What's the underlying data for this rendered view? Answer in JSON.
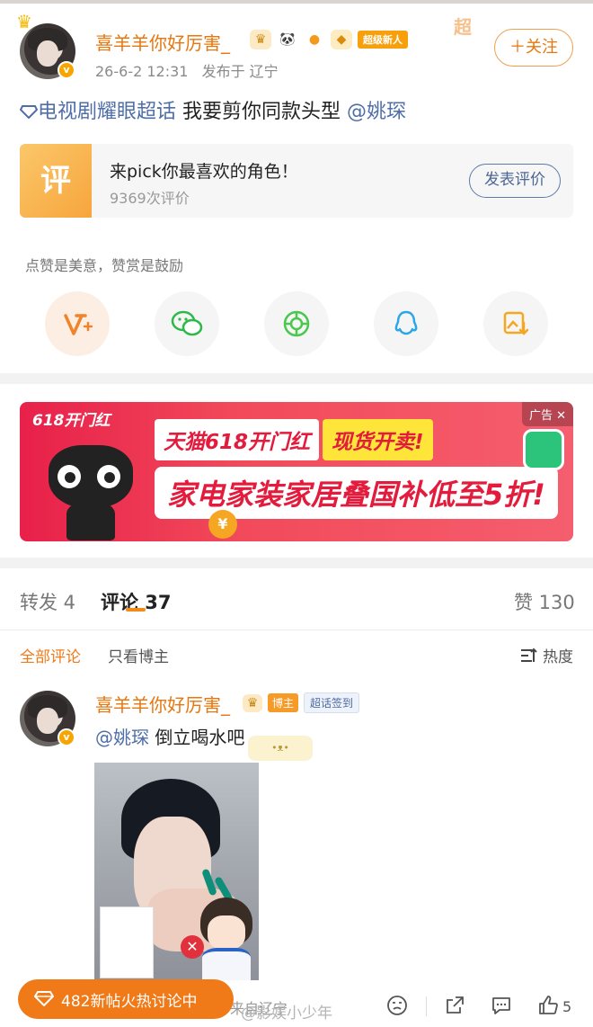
{
  "post": {
    "username": "喜羊羊你好厉害_",
    "badge_label": "超级新人",
    "date": "26-6-2 12:31",
    "location": "发布于 辽宁",
    "follow_label": "＋关注",
    "bg_label": "超",
    "topic": "电视剧耀眼超话",
    "text": " 我要剪你同款头型 ",
    "mention": "@姚琛"
  },
  "rating_card": {
    "icon_text": "评",
    "title": "来pick你最喜欢的角色！",
    "count": "9369次评价",
    "button": "发表评价"
  },
  "share": {
    "hint": "点赞是美意，赞赏是鼓励",
    "items": [
      {
        "icon": "v-plus-icon"
      },
      {
        "icon": "wechat-icon"
      },
      {
        "icon": "moments-icon"
      },
      {
        "icon": "qq-icon"
      },
      {
        "icon": "save-image-icon"
      }
    ]
  },
  "ad": {
    "tag": "广告 ✕",
    "corner": "618开门红",
    "headline_1": "天猫618开门红",
    "headline_2": "现货开卖!",
    "sub": "家电家装家居叠国补低至5折!",
    "coin": "¥"
  },
  "tabs": {
    "repost": "转发 4",
    "comments": "评论 37",
    "likes": "赞 130"
  },
  "filters": {
    "all": "全部评论",
    "blogger_only": "只看博主",
    "sort": "热度"
  },
  "comment": {
    "username": "喜羊羊你好厉害_",
    "host_tag": "博主",
    "checkin": "超话签到",
    "mention": "@姚琛",
    "text": " 倒立喝水吧"
  },
  "bottom": {
    "hot_pill": "482新帖火热讨论中",
    "location_ghost": "来自辽宁",
    "watermark": "@影娱小少年",
    "like_count": "5"
  },
  "colors": {
    "accent": "#e8760d",
    "link": "#4f6ea8",
    "hot": "#f07a18"
  }
}
